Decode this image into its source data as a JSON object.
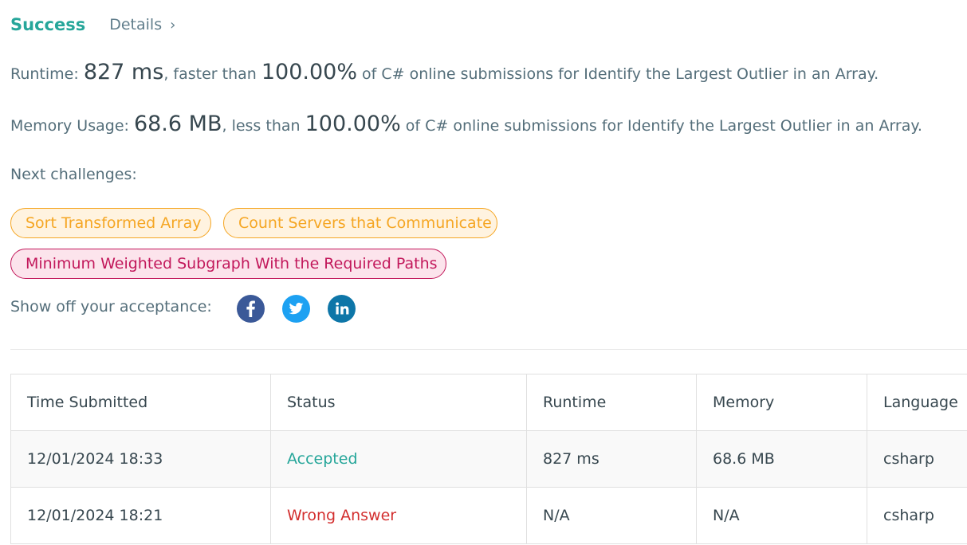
{
  "header": {
    "status": "Success",
    "details_label": "Details"
  },
  "runtime": {
    "label": "Runtime: ",
    "value": "827 ms",
    "mid": ", faster than ",
    "percent": "100.00%",
    "suffix": " of C# online submissions for Identify the Largest Outlier in an Array."
  },
  "memory": {
    "label": "Memory Usage: ",
    "value": "68.6 MB",
    "mid": ", less than ",
    "percent": "100.00%",
    "suffix": " of C# online submissions for Identify the Largest Outlier in an Array."
  },
  "next": {
    "label": "Next challenges:",
    "items": [
      {
        "label": "Sort Transformed Array",
        "difficulty": "medium"
      },
      {
        "label": "Count Servers that Communicate",
        "difficulty": "medium"
      },
      {
        "label": "Minimum Weighted Subgraph With the Required Paths",
        "difficulty": "hard"
      }
    ]
  },
  "share": {
    "label": "Show off your acceptance:",
    "icons": [
      "facebook-icon",
      "twitter-icon",
      "linkedin-icon"
    ]
  },
  "table": {
    "headers": [
      "Time Submitted",
      "Status",
      "Runtime",
      "Memory",
      "Language"
    ],
    "rows": [
      [
        "12/01/2024 18:33",
        "Accepted",
        "827 ms",
        "68.6 MB",
        "csharp"
      ],
      [
        "12/01/2024 18:21",
        "Wrong Answer",
        "N/A",
        "N/A",
        "csharp"
      ]
    ]
  },
  "colors": {
    "accepted": "#26a69a",
    "wrong": "#d32f2f",
    "medium": "#f5a623",
    "hard": "#c2185b",
    "facebook": "#3b5998",
    "twitter": "#1da1f2",
    "linkedin": "#0e76a8"
  }
}
